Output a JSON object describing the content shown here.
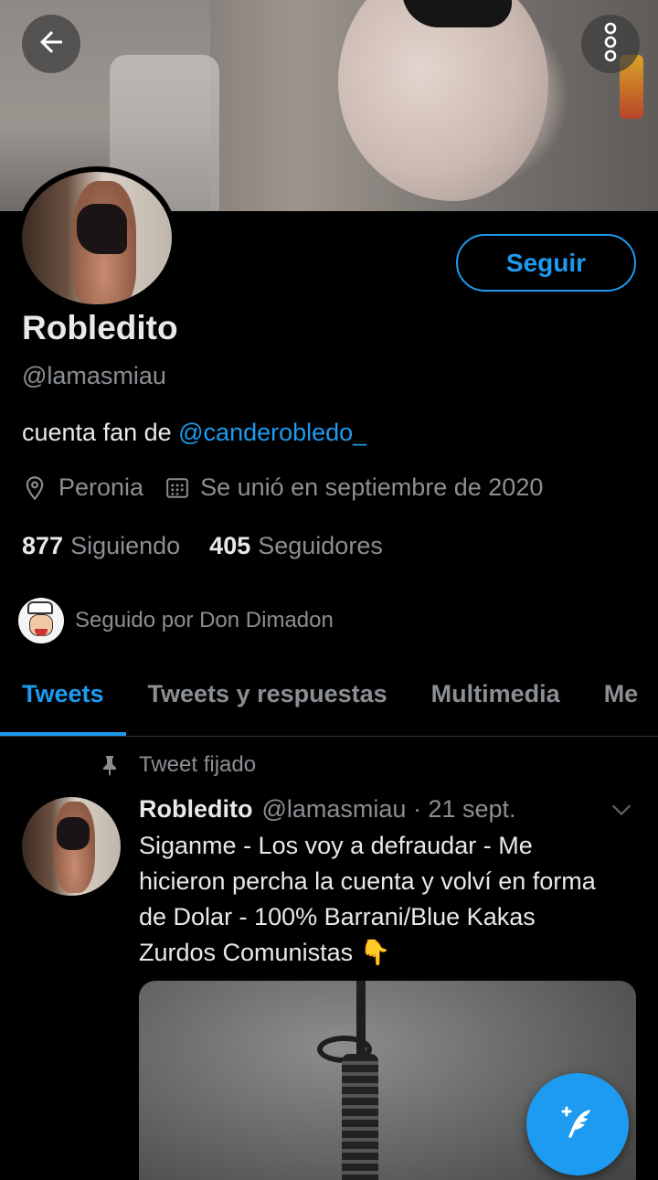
{
  "header": {
    "back_icon": "arrow-left-icon",
    "more_icon": "more-vertical-icon"
  },
  "profile": {
    "name": "Robledito",
    "handle": "@lamasmiau",
    "bio_prefix": "cuenta fan de ",
    "bio_mention": "@canderobledo_",
    "location": "Peronia",
    "joined": "Se unió en septiembre de 2020",
    "following_count": "877",
    "following_label": "Siguiendo",
    "followers_count": "405",
    "followers_label": "Seguidores",
    "followed_by": "Seguido por Don Dimadon",
    "follow_button": "Seguir"
  },
  "tabs": [
    {
      "label": "Tweets",
      "active": true
    },
    {
      "label": "Tweets y respuestas",
      "active": false
    },
    {
      "label": "Multimedia",
      "active": false
    },
    {
      "label": "Me",
      "active": false
    }
  ],
  "pinned_tweet": {
    "pinned_label": "Tweet fijado",
    "name": "Robledito",
    "handle_date": "@lamasmiau · 21 sept.",
    "text": "Siganme - Los voy a defraudar - Me hicieron percha la cuenta y volví en forma de Dolar - 100% Barrani/Blue Kakas Zurdos Comunistas 👇"
  },
  "colors": {
    "accent": "#1d9bf0",
    "background": "#000000",
    "secondary_text": "#8b8f93"
  }
}
